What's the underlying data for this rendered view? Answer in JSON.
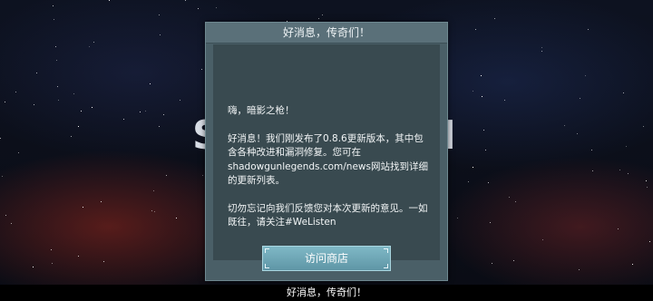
{
  "background": {
    "logo_left": "S",
    "logo_right": "N"
  },
  "dialog": {
    "title": "好消息，传奇们！",
    "greeting": "嗨，暗影之枪！",
    "paragraph1": "好消息！我们刚发布了0.8.6更新版本，其中包含各种改进和漏洞修复。您可在shadowgunlegends.com/news网站找到详细的更新列表。",
    "paragraph2": "切勿忘记向我们反馈您对本次更新的意见。一如既往，请关注#WeListen",
    "store_button": "访问商店"
  },
  "subtitle": "好消息，传奇们！",
  "colors": {
    "dialog_bg": "#4a5f67",
    "body_bg": "#394a50",
    "button": "#6fa7b6"
  }
}
